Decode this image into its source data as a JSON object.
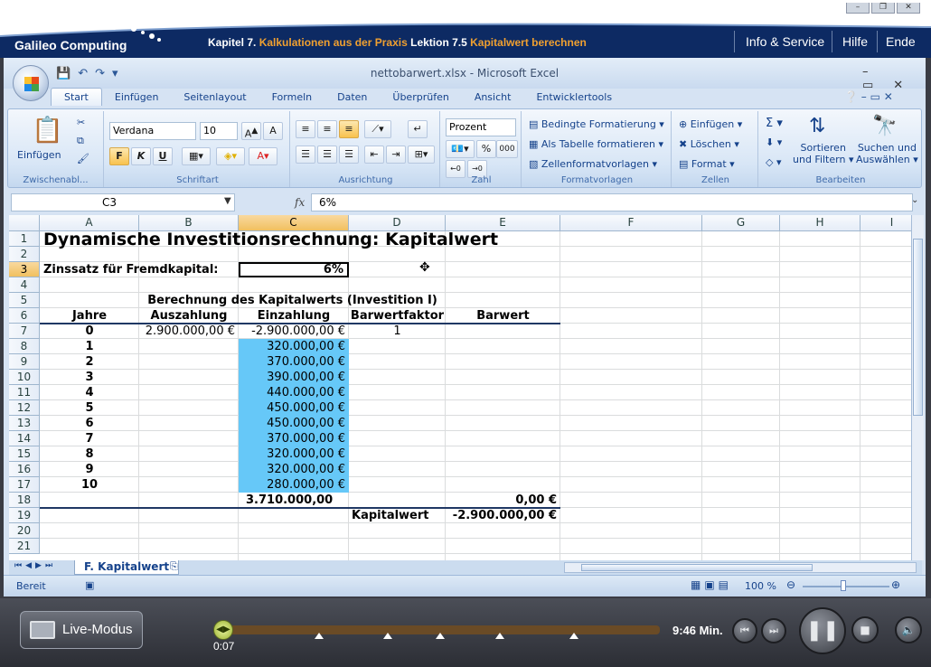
{
  "brand": {
    "logo_text": "Galileo Computing"
  },
  "breadcrumb": {
    "chapter_label": "Kapitel 7.",
    "chapter_title": "Kalkulationen aus der Praxis",
    "lesson_label": "Lektion 7.5",
    "lesson_title": "Kapitalwert berechnen"
  },
  "topnav": {
    "info": "Info & Service",
    "help": "Hilfe",
    "end": "Ende"
  },
  "excel": {
    "title": "nettobarwert.xlsx - Microsoft Excel",
    "tabs": [
      "Start",
      "Einfügen",
      "Seitenlayout",
      "Formeln",
      "Daten",
      "Überprüfen",
      "Ansicht",
      "Entwicklertools"
    ],
    "ribbon": {
      "clipboard": {
        "paste": "Einfügen",
        "label": "Zwischenabl..."
      },
      "font": {
        "name": "Verdana",
        "size": "10",
        "bold": "F",
        "italic": "K",
        "underline": "U",
        "label": "Schriftart"
      },
      "alignment": {
        "label": "Ausrichtung"
      },
      "number": {
        "format": "Prozent",
        "percent": "%",
        "thousands": "000",
        "label": "Zahl"
      },
      "styles": {
        "conditional": "Bedingte Formatierung",
        "as_table": "Als Tabelle formatieren",
        "cell_styles": "Zellenformatvorlagen",
        "label": "Formatvorlagen"
      },
      "cells": {
        "insert": "Einfügen",
        "delete": "Löschen",
        "format": "Format",
        "label": "Zellen"
      },
      "editing": {
        "sort1": "Sortieren",
        "sort2": "und Filtern",
        "find1": "Suchen und",
        "find2": "Auswählen",
        "label": "Bearbeiten"
      }
    },
    "namebox": "C3",
    "formula": "6%",
    "columns": [
      "A",
      "B",
      "C",
      "D",
      "E",
      "F",
      "G",
      "H",
      "I"
    ],
    "rows": [
      "1",
      "2",
      "3",
      "4",
      "5",
      "6",
      "7",
      "8",
      "9",
      "10",
      "11",
      "12",
      "13",
      "14",
      "15",
      "16",
      "17",
      "18",
      "19",
      "20",
      "21"
    ],
    "sheet": {
      "title": "Dynamische Investitionsrechnung: Kapitalwert",
      "rate_label": "Zinssatz für Fremdkapital:",
      "rate_value": "6%",
      "section_title": "Berechnung des Kapitalwerts (Investition I)",
      "headers": [
        "Jahre",
        "Auszahlung",
        "Einzahlung",
        "Barwertfaktor",
        "Barwert"
      ],
      "years": [
        "0",
        "1",
        "2",
        "3",
        "4",
        "5",
        "6",
        "7",
        "8",
        "9",
        "10"
      ],
      "auszahlung0": "2.900.000,00 €",
      "einzahlungen": [
        "-2.900.000,00 €",
        "320.000,00 €",
        "370.000,00 €",
        "390.000,00 €",
        "440.000,00 €",
        "450.000,00 €",
        "450.000,00 €",
        "370.000,00 €",
        "320.000,00 €",
        "320.000,00 €",
        "280.000,00 €"
      ],
      "barwertfaktor0": "1",
      "sum_einzahlung": "3.710.000,00",
      "sum_barwert": "0,00 €",
      "kapitalwert_label": "Kapitalwert",
      "kapitalwert_value": "-2.900.000,00 €",
      "highlight_color": "#66c8f8"
    },
    "sheet_tab": "F. Kapitalwert",
    "status": "Bereit",
    "zoom": "100 %"
  },
  "player": {
    "mode_button": "Live-Modus",
    "elapsed": "0:07",
    "duration": "9:46 Min.",
    "progress": 0.01
  }
}
